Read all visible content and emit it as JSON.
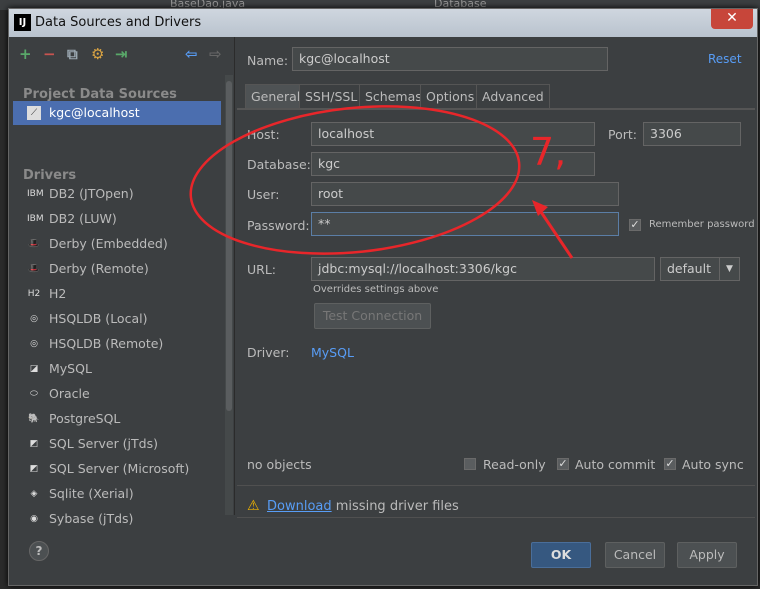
{
  "ide": {
    "tab1": "BaseDao.java",
    "tab2": "Database"
  },
  "window": {
    "title": "Data Sources and Drivers",
    "logo": "IJ",
    "close": "✕"
  },
  "toolbar": {
    "add": "+",
    "remove": "−",
    "copy": "⧉",
    "settings": "⚙",
    "import": "⇥",
    "back": "⇦",
    "forward": "⇨"
  },
  "sidebar": {
    "project_header": "Project Data Sources",
    "project_items": [
      {
        "label": "kgc@localhost",
        "icon": "database-icon"
      }
    ],
    "drivers_header": "Drivers",
    "drivers": [
      {
        "label": "DB2 (JTOpen)",
        "icon": "IBM"
      },
      {
        "label": "DB2 (LUW)",
        "icon": "IBM"
      },
      {
        "label": "Derby (Embedded)",
        "icon": "🎩"
      },
      {
        "label": "Derby (Remote)",
        "icon": "🎩"
      },
      {
        "label": "H2",
        "icon": "H2"
      },
      {
        "label": "HSQLDB (Local)",
        "icon": "◎"
      },
      {
        "label": "HSQLDB (Remote)",
        "icon": "◎"
      },
      {
        "label": "MySQL",
        "icon": "◪"
      },
      {
        "label": "Oracle",
        "icon": "⬭"
      },
      {
        "label": "PostgreSQL",
        "icon": "🐘"
      },
      {
        "label": "SQL Server (jTds)",
        "icon": "◩"
      },
      {
        "label": "SQL Server (Microsoft)",
        "icon": "◩"
      },
      {
        "label": "Sqlite (Xerial)",
        "icon": "◈"
      },
      {
        "label": "Sybase (jTds)",
        "icon": "◉"
      }
    ],
    "help": "?"
  },
  "form": {
    "name_label": "Name:",
    "name_value": "kgc@localhost",
    "reset": "Reset",
    "tabs": [
      "General",
      "SSH/SSL",
      "Schemas",
      "Options",
      "Advanced"
    ],
    "active_tab": "General",
    "host_label": "Host:",
    "host_value": "localhost",
    "port_label": "Port:",
    "port_value": "3306",
    "database_label": "Database:",
    "database_value": "kgc",
    "user_label": "User:",
    "user_value": "root",
    "password_label": "Password:",
    "password_value": "**",
    "remember_password": "Remember password",
    "remember_checked": true,
    "url_label": "URL:",
    "url_value": "jdbc:mysql://localhost:3306/kgc",
    "url_mode": "default",
    "url_hint": "Overrides settings above",
    "test_connection": "Test Connection",
    "driver_label": "Driver:",
    "driver_value": "MySQL",
    "status": "no objects",
    "read_only": "Read-only",
    "read_only_checked": false,
    "auto_commit": "Auto commit",
    "auto_commit_checked": true,
    "auto_sync": "Auto sync",
    "auto_sync_checked": true,
    "warning_link": "Download",
    "warning_text": " missing driver files"
  },
  "buttons": {
    "ok": "OK",
    "cancel": "Cancel",
    "apply": "Apply"
  },
  "annotation": {
    "text": "7,",
    "color": "#e8262a"
  }
}
